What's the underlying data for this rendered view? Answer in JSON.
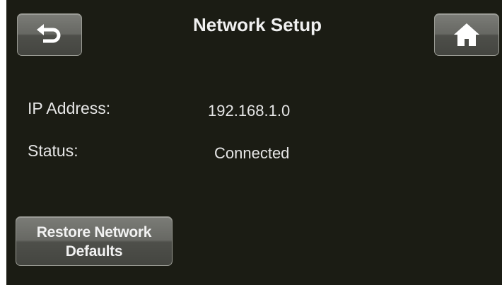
{
  "header": {
    "title": "Network Setup",
    "back_icon": "back-arrow-icon",
    "home_icon": "home-icon"
  },
  "info": {
    "ip_label": "IP Address:",
    "ip_value": "192.168.1.0",
    "status_label": "Status:",
    "status_value": "Connected"
  },
  "actions": {
    "restore_label": "Restore Network\nDefaults"
  },
  "colors": {
    "background": "#1b1c14",
    "button": "#676863",
    "text": "#e8e8e8"
  }
}
